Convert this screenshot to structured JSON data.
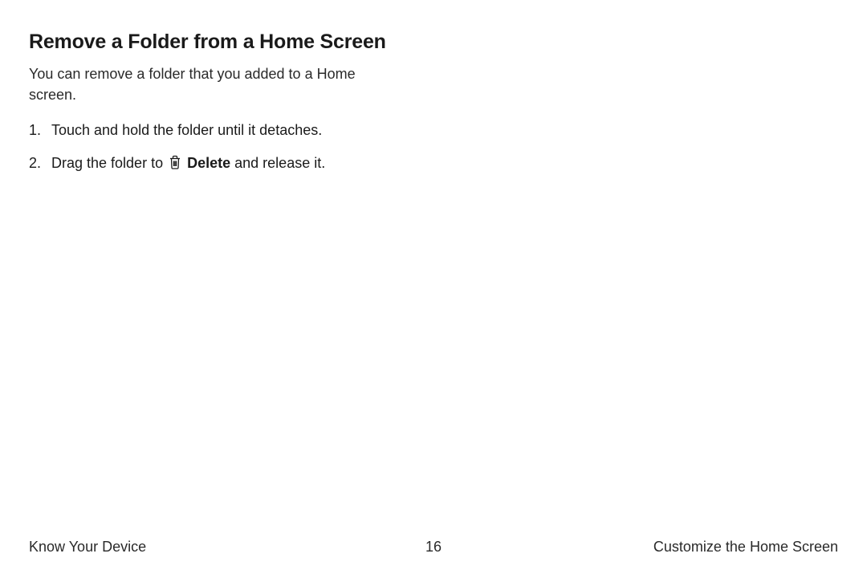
{
  "heading": "Remove a Folder from a Home Screen",
  "intro": "You can remove a folder that you added to a Home screen.",
  "steps": {
    "item1": "Touch and hold the folder until it detaches.",
    "item2_prefix": "Drag the folder to ",
    "item2_bold": "Delete",
    "item2_suffix": " and release it."
  },
  "footer": {
    "left": "Know Your Device",
    "center": "16",
    "right": "Customize the Home Screen"
  }
}
